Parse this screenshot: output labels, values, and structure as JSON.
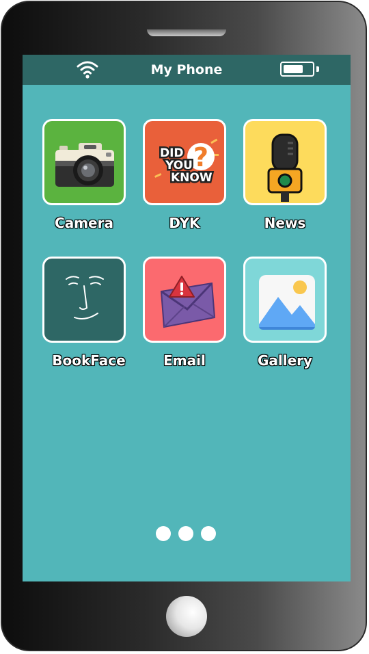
{
  "status_bar": {
    "title": "My Phone",
    "wifi_icon": "wifi-icon",
    "battery_icon": "battery-icon",
    "battery_level": 0.7
  },
  "apps": [
    {
      "label": "Camera",
      "icon": "camera-icon",
      "tile_color": "#5bb33f"
    },
    {
      "label": "DYK",
      "icon": "did-you-know-icon",
      "tile_color": "#e9603a",
      "icon_text": [
        "DID",
        "YOU",
        "KNOW"
      ]
    },
    {
      "label": "News",
      "icon": "microphone-icon",
      "tile_color": "#fddb5c"
    },
    {
      "label": "BookFace",
      "icon": "face-icon",
      "tile_color": "#2e6765"
    },
    {
      "label": "Email",
      "icon": "envelope-alert-icon",
      "tile_color": "#fb6a6f"
    },
    {
      "label": "Gallery",
      "icon": "image-icon",
      "tile_color": "#7fd7d8"
    }
  ],
  "pagination": {
    "pages": 3
  },
  "colors": {
    "screen": "#52b6b9",
    "status_bar": "#2e6765"
  }
}
